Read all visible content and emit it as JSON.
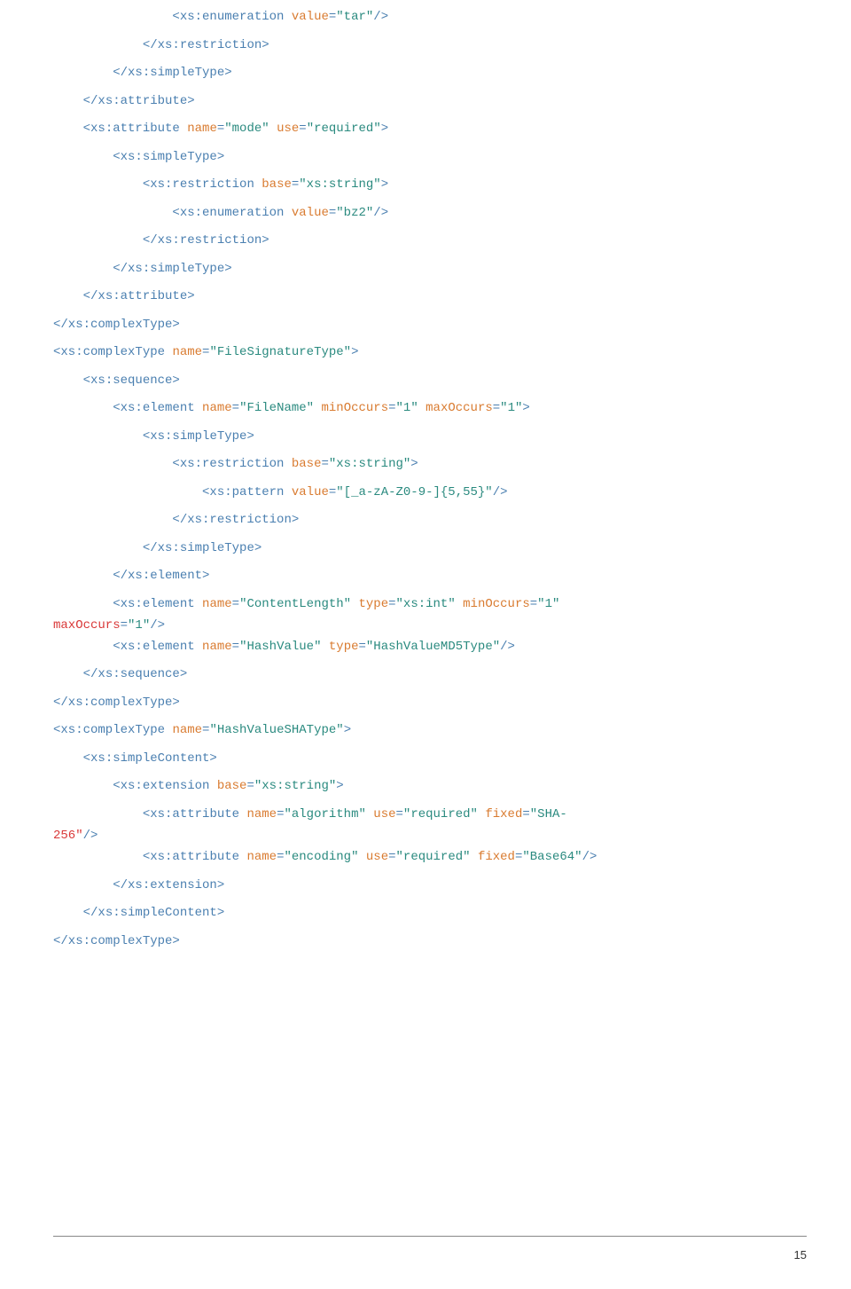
{
  "page_number": "15",
  "tokens": {
    "open_enum": "<xs:enumeration",
    "value_attr": "value",
    "close_restriction": "</xs:restriction>",
    "close_simpleType": "</xs:simpleType>",
    "close_attribute": "</xs:attribute>",
    "open_attribute": "<xs:attribute",
    "name_attr": "name",
    "use_attr": "use",
    "open_simpleType": "<xs:simpleType>",
    "open_restriction": "<xs:restriction",
    "base_attr": "base",
    "close_complexType": "</xs:complexType>",
    "open_complexType": "<xs:complexType",
    "open_sequence": "<xs:sequence>",
    "open_element": "<xs:element",
    "minOccurs_attr": "minOccurs",
    "maxOccurs_attr": "maxOccurs",
    "open_pattern": "<xs:pattern",
    "close_element": "</xs:element>",
    "type_attr": "type",
    "close_sequence": "</xs:sequence>",
    "open_simpleContent": "<xs:simpleContent>",
    "open_extension": "<xs:extension",
    "fixed_attr": "fixed",
    "close_extension": "</xs:extension>",
    "close_simpleContent": "</xs:simpleContent>"
  },
  "values": {
    "tar": "\"tar\"",
    "mode": "\"mode\"",
    "required": "\"required\"",
    "xs_string": "\"xs:string\"",
    "bz2": "\"bz2\"",
    "FileSignatureType": "\"FileSignatureType\"",
    "FileName": "\"FileName\"",
    "one": "\"1\"",
    "pattern": "\"[_a-zA-Z0-9-]{5,55}\"",
    "ContentLength": "\"ContentLength\"",
    "xs_int": "\"xs:int\"",
    "HashValue": "\"HashValue\"",
    "HashValueMD5Type": "\"HashValueMD5Type\"",
    "HashValueSHAType": "\"HashValueSHAType\"",
    "algorithm": "\"algorithm\"",
    "SHA256": "\"SHA-",
    "SHA256_rest": "256\"",
    "encoding": "\"encoding\"",
    "Base64": "\"Base64\""
  }
}
